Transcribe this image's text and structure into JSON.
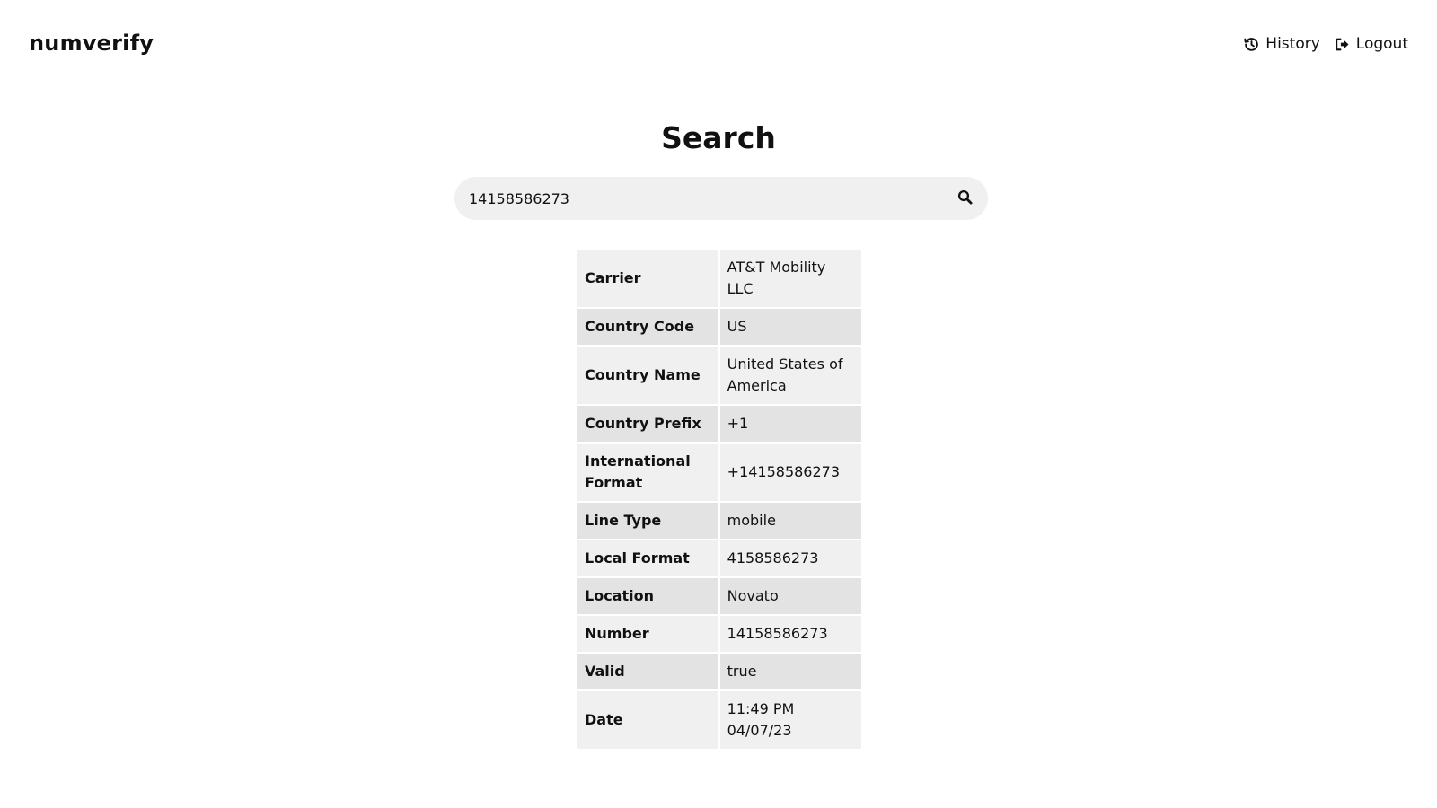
{
  "app": {
    "name": "numverify"
  },
  "nav": [
    {
      "label": "History",
      "icon": "history-icon"
    },
    {
      "label": "Logout",
      "icon": "logout-icon"
    }
  ],
  "page": {
    "title": "Search"
  },
  "search": {
    "value": "14158586273",
    "icon": "search-icon"
  },
  "results": [
    {
      "key": "Carrier",
      "value": "AT&T Mobility LLC"
    },
    {
      "key": "Country Code",
      "value": "US"
    },
    {
      "key": "Country Name",
      "value": "United States of America"
    },
    {
      "key": "Country Prefix",
      "value": "+1"
    },
    {
      "key": "International Format",
      "value": "+14158586273"
    },
    {
      "key": "Line Type",
      "value": "mobile"
    },
    {
      "key": "Local Format",
      "value": "4158586273"
    },
    {
      "key": "Location",
      "value": "Novato"
    },
    {
      "key": "Number",
      "value": "14158586273"
    },
    {
      "key": "Valid",
      "value": "true"
    },
    {
      "key": "Date",
      "value": "11:49 PM 04/07/23"
    }
  ],
  "colors": {
    "text": "#111111",
    "row_light": "#f0f0f0",
    "row_dark": "#e3e3e3",
    "search_bg": "#f0f0f0"
  }
}
